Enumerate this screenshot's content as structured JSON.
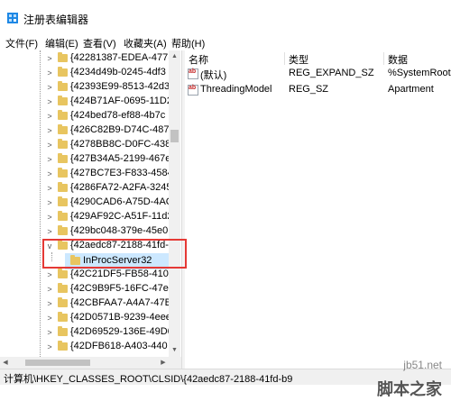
{
  "window": {
    "title": "注册表编辑器"
  },
  "menu": [
    "文件(F)",
    "编辑(E)",
    "查看(V)",
    "收藏夹(A)",
    "帮助(H)"
  ],
  "tree": {
    "items": [
      {
        "label": "{42281387-EDEA-477(",
        "expanded": false
      },
      {
        "label": "{4234d49b-0245-4df3",
        "expanded": false
      },
      {
        "label": "{42393E99-8513-42d3",
        "expanded": false
      },
      {
        "label": "{424B71AF-0695-11D2",
        "expanded": false
      },
      {
        "label": "{424bed78-ef88-4b7c",
        "expanded": false
      },
      {
        "label": "{426C82B9-D74C-487",
        "expanded": false
      },
      {
        "label": "{4278BB8C-D0FC-438(",
        "expanded": false
      },
      {
        "label": "{427B34A5-2199-467e",
        "expanded": false
      },
      {
        "label": "{427BC7E3-F833-4584",
        "expanded": false
      },
      {
        "label": "{4286FA72-A2FA-3245",
        "expanded": false
      },
      {
        "label": "{4290CAD6-A75D-4AC",
        "expanded": false
      },
      {
        "label": "{429AF92C-A51F-11d2",
        "expanded": false
      },
      {
        "label": "{429bc048-379e-45e0",
        "expanded": false
      },
      {
        "label": "{42aedc87-2188-41fd-",
        "expanded": true
      },
      {
        "label": "InProcServer32",
        "selected": true,
        "child": true
      },
      {
        "label": "{42C21DF5-FB58-4102",
        "expanded": false
      },
      {
        "label": "{42C9B9F5-16FC-47ef",
        "expanded": false
      },
      {
        "label": "{42CBFAA7-A4A7-47B",
        "expanded": false
      },
      {
        "label": "{42D0571B-9239-4eee",
        "expanded": false
      },
      {
        "label": "{42D69529-136E-49D6",
        "expanded": false
      },
      {
        "label": "{42DFB618-A403-440",
        "expanded": false
      }
    ]
  },
  "values": {
    "headers": {
      "name": "名称",
      "type": "类型",
      "data": "数据"
    },
    "rows": [
      {
        "name": "(默认)",
        "type": "REG_EXPAND_SZ",
        "data": "%SystemRoot",
        "icon": "string-value-icon"
      },
      {
        "name": "ThreadingModel",
        "type": "REG_SZ",
        "data": "Apartment",
        "icon": "string-value-icon"
      }
    ]
  },
  "status": {
    "path": "计算机\\HKEY_CLASSES_ROOT\\CLSID\\{42aedc87-2188-41fd-b9"
  },
  "watermark": {
    "site": "jb51.net",
    "name": "脚本之家"
  },
  "colors": {
    "selection": "#cce8ff",
    "highlight_border": "#e53935",
    "folder": "#e8c560"
  }
}
